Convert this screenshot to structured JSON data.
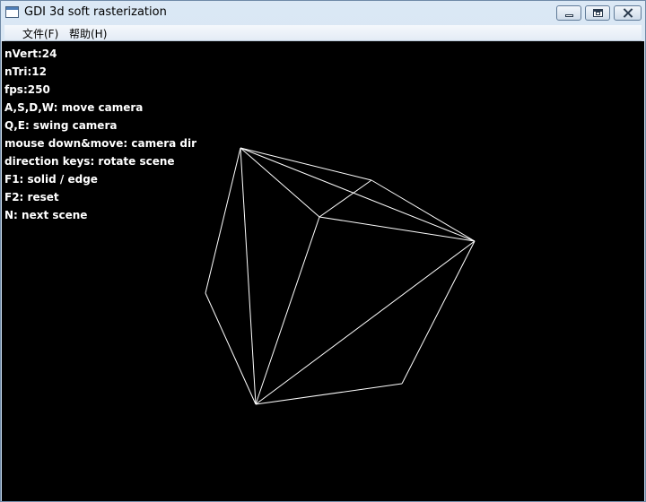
{
  "window": {
    "title": "GDI 3d soft rasterization",
    "controls": {
      "minimize": "minimize",
      "maximize": "maximize",
      "close": "close"
    }
  },
  "menu": {
    "file": "文件(F)",
    "help": "帮助(H)"
  },
  "hud": {
    "lines": [
      "nVert:24",
      "nTri:12",
      "fps:250",
      "A,S,D,W: move camera",
      "Q,E: swing camera",
      "mouse down&move: camera dir",
      "direction keys: rotate scene",
      "F1: solid / edge",
      "F2: reset",
      "N: next scene"
    ]
  },
  "colors": {
    "background": "#000000",
    "wireframe": "#ffffff"
  },
  "icons": {
    "app": "window-app-icon",
    "minimize": "minimize-icon",
    "maximize": "maximize-icon",
    "close": "close-icon"
  }
}
